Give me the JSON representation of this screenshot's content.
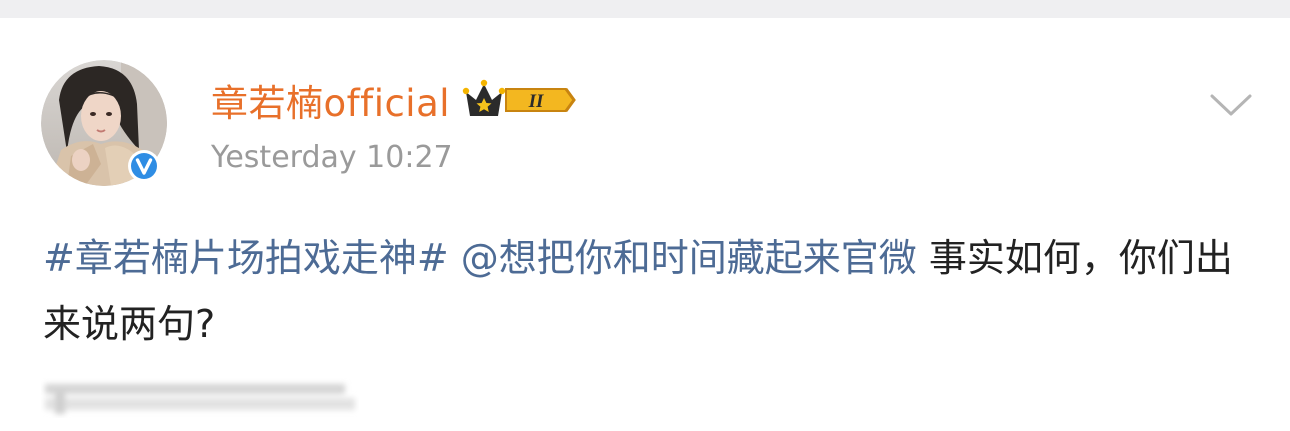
{
  "post": {
    "username": "章若楠official",
    "timestamp": "Yesterday 10:27",
    "vip_level": "II",
    "text": {
      "hashtag": "#章若楠片场拍戏走神#",
      "mention": "@想把你和时间藏起来官微",
      "body": "事实如何，你们出来说两句?"
    }
  },
  "colors": {
    "username": "#e8702a",
    "link": "#4d6b95",
    "timestamp": "#9a9a9a",
    "verified": "#2f8de4",
    "top_band": "#efeff1"
  },
  "icons": {
    "verified": "verified-v-icon",
    "vip": "crown-vip-icon",
    "more": "chevron-down-icon"
  }
}
